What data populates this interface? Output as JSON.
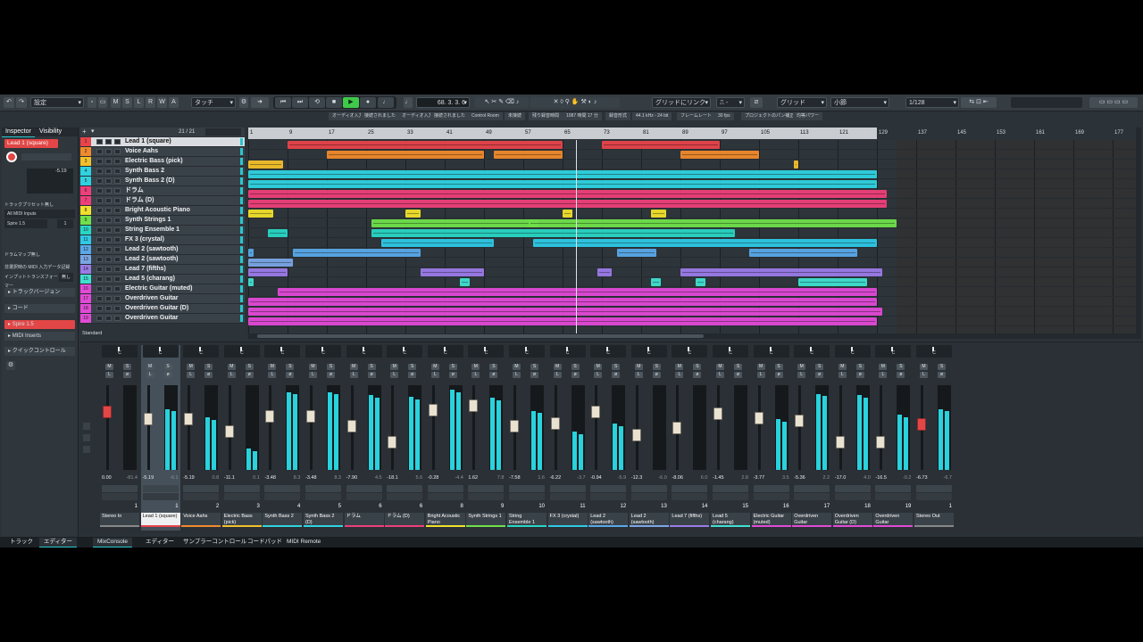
{
  "toolbar": {
    "preset_label": "設定",
    "mode_buttons": [
      "M",
      "S",
      "L",
      "R",
      "W",
      "A"
    ],
    "automation_mode": "タッチ",
    "position_display": "68. 3. 3.  6",
    "snap_type": "グリッドにリンク",
    "grid_type": "グリッド",
    "grid_value": "小節",
    "quantize": "1/128"
  },
  "status_bar": [
    "オーディオ入力",
    "接続されました",
    "オーディオ入力",
    "接続されました",
    "Control Room",
    "未接続",
    "残り録音時間",
    "1087 時間 17 分",
    "録音形式",
    "44.1 kHz - 24 bit",
    "フレームレート",
    "30 fps",
    "プロジェクトのパン補正",
    "均等パワー"
  ],
  "inspector": {
    "tabs": [
      "Inspector",
      "Visibility"
    ],
    "track_name": "Lead 1 (square)",
    "volume_value": "-5.19",
    "routing_input": "All MIDI Inputs",
    "routing_output": "Spire 1.5",
    "midi_channel": "1",
    "label_thru": "トラックプリセット無し",
    "label_keyswitch": "ドラムマップ無し",
    "label_note": "非選択時の MIDI 入力データ記録",
    "label_input_transformer": "インプットトランスフォーマー",
    "input_transformer_value": "無し",
    "sections": [
      "トラックバージョン",
      "コード",
      "Spire 1.5",
      "MIDI Inserts",
      "クイックコントロール"
    ]
  },
  "tracklist": {
    "count": "21 / 21",
    "preset": "Standard",
    "tracks": [
      {
        "num": "1",
        "name": "Lead 1 (square)",
        "color": "#e8444a"
      },
      {
        "num": "2",
        "name": "Voice Aahs",
        "color": "#f08a2c"
      },
      {
        "num": "3",
        "name": "Electric Bass (pick)",
        "color": "#f2c02a"
      },
      {
        "num": "4",
        "name": "Synth Bass 2",
        "color": "#2fd3e0"
      },
      {
        "num": "5",
        "name": "Synth Bass 2 (D)",
        "color": "#2fd3e0"
      },
      {
        "num": "6",
        "name": "ドラム",
        "color": "#ee3f7a"
      },
      {
        "num": "7",
        "name": "ドラム (D)",
        "color": "#ee3f7a"
      },
      {
        "num": "8",
        "name": "Bright Acoustic Piano",
        "color": "#f0e02c"
      },
      {
        "num": "9",
        "name": "Synth Strings 1",
        "color": "#6fe04a"
      },
      {
        "num": "10",
        "name": "String Ensemble 1",
        "color": "#29d6c4"
      },
      {
        "num": "11",
        "name": "FX 3 (crystal)",
        "color": "#2fc9e6"
      },
      {
        "num": "12",
        "name": "Lead 2 (sawtooth)",
        "color": "#5aa8e8"
      },
      {
        "num": "13",
        "name": "Lead 2 (sawtooth)",
        "color": "#7aa6e6"
      },
      {
        "num": "14",
        "name": "Lead 7 (fifths)",
        "color": "#9b7be8"
      },
      {
        "num": "15",
        "name": "Lead 5 (charang)",
        "color": "#3fe0cf"
      },
      {
        "num": "16",
        "name": "Electric Guitar (muted)",
        "color": "#e24ad6"
      },
      {
        "num": "17",
        "name": "Overdriven Guitar",
        "color": "#e24ad6"
      },
      {
        "num": "18",
        "name": "Overdriven Guitar (D)",
        "color": "#e24ad6"
      },
      {
        "num": "19",
        "name": "Overdriven Guitar",
        "color": "#e24ad6"
      }
    ]
  },
  "ruler": [
    "1",
    "9",
    "17",
    "25",
    "33",
    "41",
    "49",
    "57",
    "65",
    "73",
    "81",
    "89",
    "97",
    "105",
    "113",
    "121",
    "129",
    "137",
    "145",
    "153",
    "161",
    "169",
    "177"
  ],
  "mixer": {
    "strips": [
      {
        "idx": "1",
        "name": "Stereo In",
        "val": "0.00",
        "peak": "-81.4",
        "color": "#888",
        "fader": 0.72,
        "meter": 0.0,
        "red": true
      },
      {
        "idx": "1",
        "name": "Lead 1 (square)",
        "val": "-5.19",
        "peak": "-6.1",
        "color": "#e8444a",
        "fader": 0.62,
        "meter": 0.72,
        "sel": true
      },
      {
        "idx": "2",
        "name": "Voice Aahs",
        "val": "-5.19",
        "peak": "0.8",
        "color": "#f08a2c",
        "fader": 0.62,
        "meter": 0.62
      },
      {
        "idx": "3",
        "name": "Electric Bass (pick)",
        "val": "-11.1",
        "peak": "0.1",
        "color": "#f2c02a",
        "fader": 0.45,
        "meter": 0.25
      },
      {
        "idx": "4",
        "name": "Synth Bass 2",
        "val": "-3.48",
        "peak": "8.3",
        "color": "#2fd3e0",
        "fader": 0.66,
        "meter": 0.92
      },
      {
        "idx": "5",
        "name": "Synth Bass 2 (D)",
        "val": "-3.48",
        "peak": "8.3",
        "color": "#2fd3e0",
        "fader": 0.66,
        "meter": 0.92
      },
      {
        "idx": "6",
        "name": "ドラム",
        "val": "-7.90",
        "peak": "4.5",
        "color": "#ee3f7a",
        "fader": 0.52,
        "meter": 0.88
      },
      {
        "idx": "6",
        "name": "ドラム (D)",
        "val": "-18.1",
        "peak": "5.6",
        "color": "#ee3f7a",
        "fader": 0.3,
        "meter": 0.86
      },
      {
        "idx": "8",
        "name": "Bright Acoustic Piano",
        "val": "-0.28",
        "peak": "-4.4",
        "color": "#f0e02c",
        "fader": 0.74,
        "meter": 0.95
      },
      {
        "idx": "9",
        "name": "Synth Strings 1",
        "val": "1.62",
        "peak": "7.8",
        "color": "#6fe04a",
        "fader": 0.8,
        "meter": 0.85
      },
      {
        "idx": "10",
        "name": "String Ensemble 1",
        "val": "-7.58",
        "peak": "1.6",
        "color": "#29d6c4",
        "fader": 0.52,
        "meter": 0.7
      },
      {
        "idx": "11",
        "name": "FX 3 (crystal)",
        "val": "-6.22",
        "peak": "-3.7",
        "color": "#2fc9e6",
        "fader": 0.56,
        "meter": 0.45
      },
      {
        "idx": "12",
        "name": "Lead 2 (sawtooth)",
        "val": "-0.94",
        "peak": "-5.9",
        "color": "#5aa8e8",
        "fader": 0.72,
        "meter": 0.55
      },
      {
        "idx": "13",
        "name": "Lead 2 (sawtooth)",
        "val": "-12.3",
        "peak": "-6.0",
        "color": "#7aa6e6",
        "fader": 0.4,
        "meter": 0.0
      },
      {
        "idx": "14",
        "name": "Lead 7 (fifths)",
        "val": "-8.06",
        "peak": "6.0",
        "color": "#9b7be8",
        "fader": 0.5,
        "meter": 0.0
      },
      {
        "idx": "15",
        "name": "Lead 5 (charang)",
        "val": "-1.45",
        "peak": "2.8",
        "color": "#3fe0cf",
        "fader": 0.7,
        "meter": 0.0
      },
      {
        "idx": "16",
        "name": "Electric Guitar (muted)",
        "val": "-3.77",
        "peak": "3.5",
        "color": "#e24ad6",
        "fader": 0.64,
        "meter": 0.6
      },
      {
        "idx": "17",
        "name": "Overdriven Guitar",
        "val": "-5.36",
        "peak": "2.2",
        "color": "#e24ad6",
        "fader": 0.6,
        "meter": 0.9
      },
      {
        "idx": "18",
        "name": "Overdriven Guitar (D)",
        "val": "-17.0",
        "peak": "4.0",
        "color": "#e24ad6",
        "fader": 0.3,
        "meter": 0.88
      },
      {
        "idx": "19",
        "name": "Overdriven Guitar",
        "val": "-16.5",
        "peak": "-0.2",
        "color": "#e24ad6",
        "fader": 0.3,
        "meter": 0.65
      },
      {
        "idx": "1",
        "name": "Stereo Out",
        "val": "-6.73",
        "peak": "-6.7",
        "color": "#888",
        "fader": 0.55,
        "meter": 0.72,
        "red": true
      }
    ]
  },
  "bottom_tabs": [
    "トラック",
    "エディター",
    "MixConsole",
    "エディター",
    "サンプラーコントロール",
    "コードパッド",
    "MIDI Remote"
  ]
}
